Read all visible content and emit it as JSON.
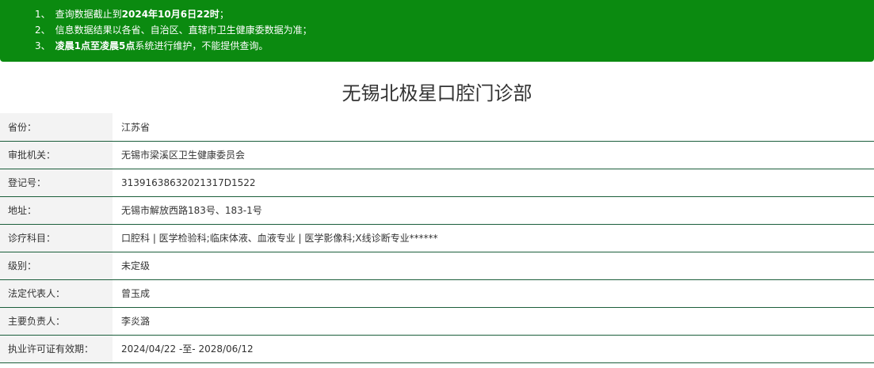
{
  "notice": {
    "line1": {
      "num": "1、",
      "pre": "查询数据截止到",
      "bold": "2024年10月6日22时",
      "post": "；"
    },
    "line2": {
      "num": "2、",
      "text": "信息数据结果以各省、自治区、直辖市卫生健康委数据为准；"
    },
    "line3": {
      "num": "3、",
      "bold": "凌晨1点至凌晨5点",
      "post": "系统进行维护，不能提供查询。"
    }
  },
  "title": "无锡北极星口腔门诊部",
  "rows": [
    {
      "label": "省份：",
      "value": "江苏省"
    },
    {
      "label": "审批机关：",
      "value": "无锡市梁溪区卫生健康委员会"
    },
    {
      "label": "登记号：",
      "value": "31391638632021317D1522"
    },
    {
      "label": "地址：",
      "value": "无锡市解放西路183号、183-1号"
    },
    {
      "label": "诊疗科目：",
      "value": "口腔科 | 医学检验科;临床体液、血液专业 | 医学影像科;X线诊断专业******"
    },
    {
      "label": "级别：",
      "value": "未定级"
    },
    {
      "label": "法定代表人：",
      "value": "曾玉成"
    },
    {
      "label": "主要负责人：",
      "value": "李炎潞"
    },
    {
      "label": "执业许可证有效期：",
      "value": "2024/04/22 -至- 2028/06/12"
    }
  ]
}
